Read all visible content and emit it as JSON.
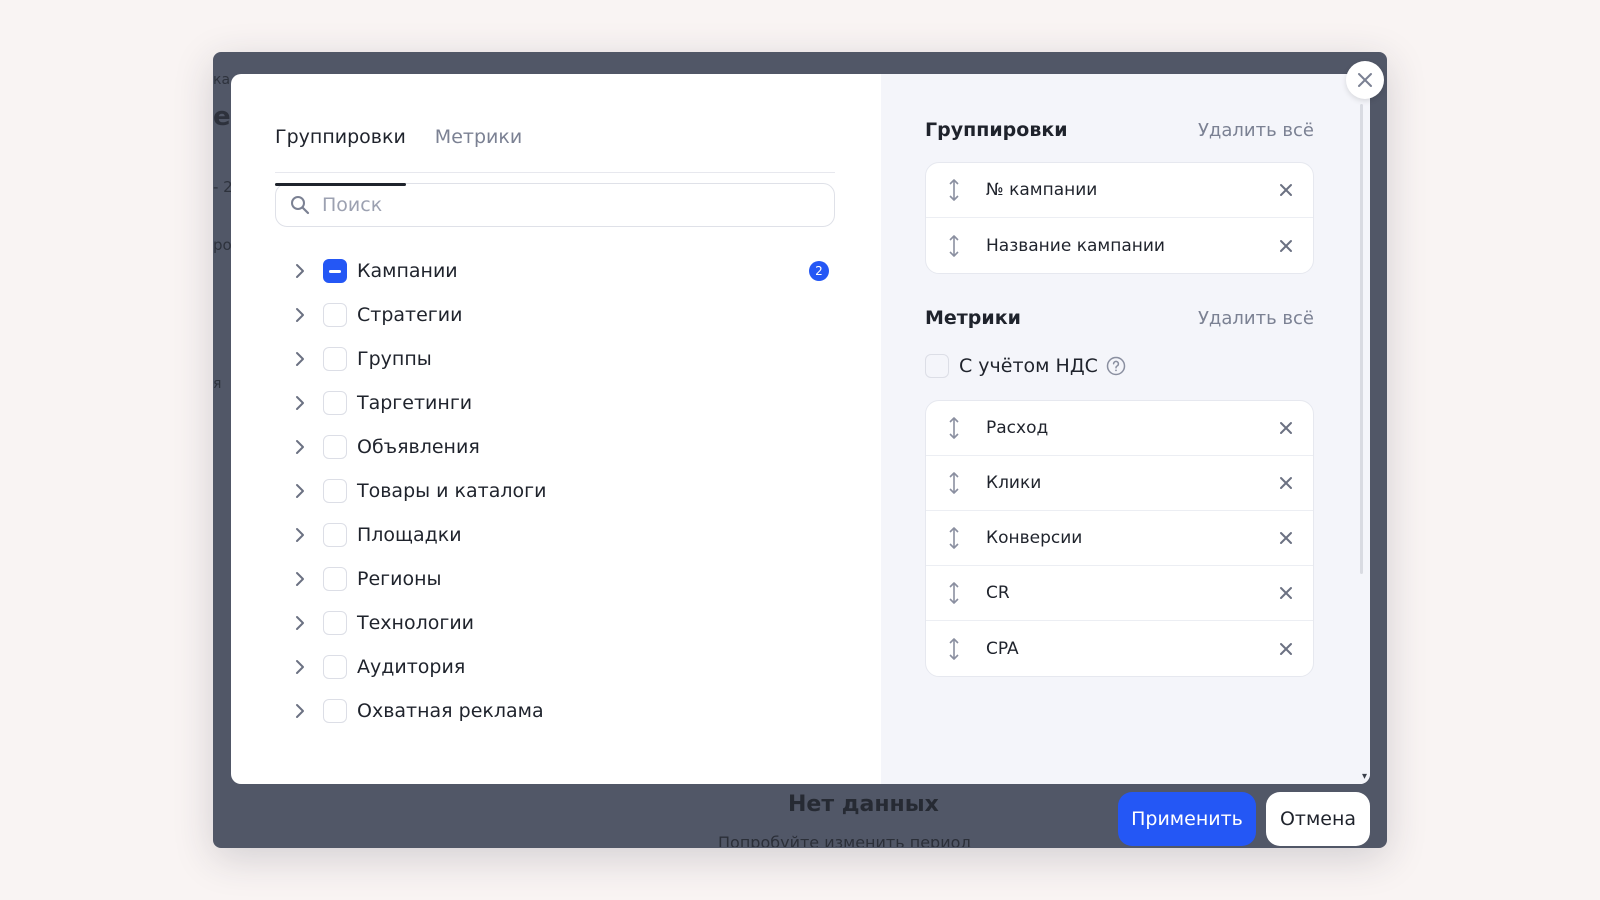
{
  "background": {
    "fragments": [
      "ка",
      "е",
      "- 2",
      "ро",
      "я"
    ],
    "empty_title": "Нет данных",
    "empty_subtitle": "Попробуйте изменить период"
  },
  "tabs": [
    {
      "label": "Группировки",
      "active": true
    },
    {
      "label": "Метрики",
      "active": false
    }
  ],
  "search": {
    "placeholder": "Поиск",
    "value": ""
  },
  "tree": [
    {
      "label": "Кампании",
      "state": "indeterminate",
      "count": "2"
    },
    {
      "label": "Стратегии",
      "state": "unchecked"
    },
    {
      "label": "Группы",
      "state": "unchecked"
    },
    {
      "label": "Таргетинги",
      "state": "unchecked"
    },
    {
      "label": "Объявления",
      "state": "unchecked"
    },
    {
      "label": "Товары и каталоги",
      "state": "unchecked"
    },
    {
      "label": "Площадки",
      "state": "unchecked"
    },
    {
      "label": "Регионы",
      "state": "unchecked"
    },
    {
      "label": "Технологии",
      "state": "unchecked"
    },
    {
      "label": "Аудитория",
      "state": "unchecked"
    },
    {
      "label": "Охватная реклама",
      "state": "unchecked"
    }
  ],
  "selected_groupings": {
    "title": "Группировки",
    "remove_all": "Удалить всё",
    "items": [
      "№ кампании",
      "Название кампании"
    ]
  },
  "selected_metrics": {
    "title": "Метрики",
    "remove_all": "Удалить всё",
    "vat_label": "С учётом НДС",
    "vat_checked": false,
    "items": [
      "Расход",
      "Клики",
      "Конверсии",
      "CR",
      "CPA"
    ]
  },
  "buttons": {
    "apply": "Применить",
    "cancel": "Отмена"
  },
  "colors": {
    "accent": "#2457f5",
    "overlay": "#515767",
    "right_pane_bg": "#f4f5fa"
  }
}
